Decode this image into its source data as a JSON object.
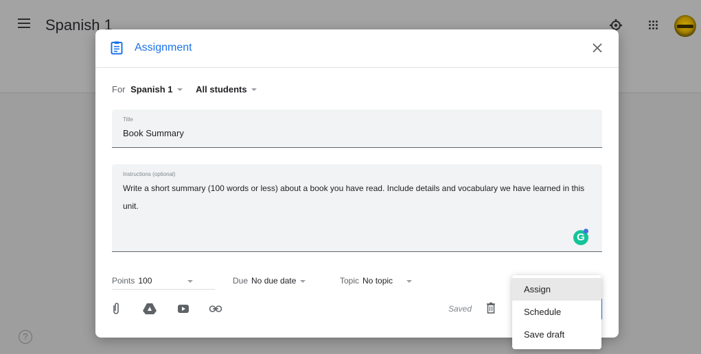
{
  "background": {
    "class_title": "Spanish 1",
    "help_glyph": "?"
  },
  "dialog": {
    "title": "Assignment",
    "for_label": "For",
    "class_select": "Spanish 1",
    "students_select": "All students",
    "title_field": {
      "label": "Title",
      "value": "Book Summary"
    },
    "instructions_field": {
      "label": "Instructions (optional)",
      "value": "Write a short summary (100 words or less) about a book you have read. Include details and vocabulary we have learned in this unit."
    },
    "grammarly_glyph": "G",
    "points": {
      "label": "Points",
      "value": "100"
    },
    "due": {
      "label": "Due",
      "value": "No due date"
    },
    "topic": {
      "label": "Topic",
      "value": "No topic"
    },
    "status": "Saved"
  },
  "assign_menu": {
    "items": [
      "Assign",
      "Schedule",
      "Save draft"
    ]
  },
  "colors": {
    "accent": "#1a73e8",
    "grammarly": "#15c39a",
    "scrim": "#9e9e9e"
  },
  "icons": [
    "menu-icon",
    "settings-icon",
    "apps-icon",
    "document-icon",
    "close-icon",
    "paperclip-icon",
    "drive-icon",
    "youtube-icon",
    "link-icon",
    "trash-icon",
    "help-icon",
    "grammarly-icon"
  ]
}
